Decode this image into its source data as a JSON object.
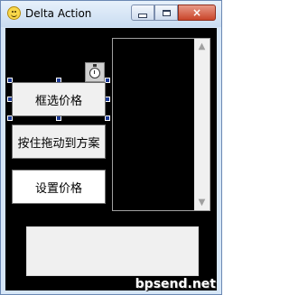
{
  "window": {
    "title": "Delta Action",
    "icon": "smiley-icon",
    "controls": {
      "minimize": "minimize-icon",
      "maximize": "maximize-icon",
      "close": "×"
    }
  },
  "buttons": {
    "select_price": "框选价格",
    "drag_to_scheme": "按住拖动到方案",
    "set_price": "设置价格"
  },
  "timer": {
    "icon": "stopwatch-icon"
  },
  "listbox": {
    "scroll_up": "▲",
    "scroll_down": "▼"
  },
  "watermark": "bpsend.net"
}
